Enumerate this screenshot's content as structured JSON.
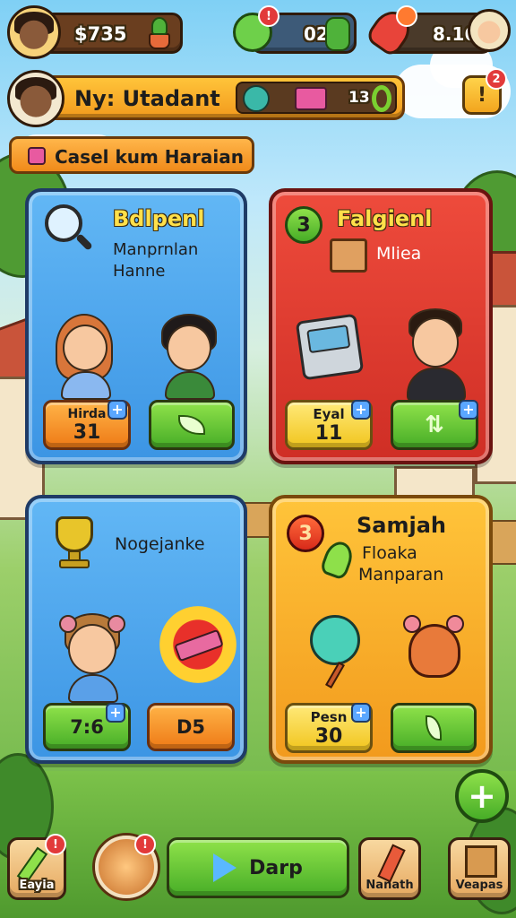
{
  "hud": {
    "money": "$735",
    "gems": "02",
    "score": "8.16",
    "mail_badge": "2"
  },
  "player": {
    "name": "Ny: Utadant",
    "item_count": "13"
  },
  "quest_banner": "Casel kum Haraian",
  "cards": [
    {
      "title": "Bdlpenl",
      "subtitle_line1": "Manprnlan",
      "subtitle_line2": "Hanne",
      "stat_label": "Hirda",
      "stat_value": "31",
      "theme": "blue"
    },
    {
      "badge_number": "3",
      "title": "Falgienl",
      "subtitle_line1": "Mliea",
      "stat_label": "Eyal",
      "stat_value": "11",
      "theme": "red"
    },
    {
      "title": "Nogejanke",
      "stat_value": "7:6",
      "button_label": "D5",
      "theme": "blue"
    },
    {
      "badge_number": "3",
      "title": "Samjah",
      "subtitle_line1": "Floaka",
      "subtitle_line2": "Manparan",
      "stat_label": "Pesn",
      "stat_value": "30",
      "theme": "orange"
    }
  ],
  "bottom_nav": {
    "left_label": "Eayia",
    "play_label": "Darp",
    "right1_label": "Nanath",
    "right2_label": "Veapas"
  },
  "colors": {
    "card_blue": "#3c95e4",
    "card_red": "#cf2e25",
    "card_orange": "#f29a1d",
    "button_green": "#47ad27",
    "hud_brown": "#6a3e1f"
  }
}
